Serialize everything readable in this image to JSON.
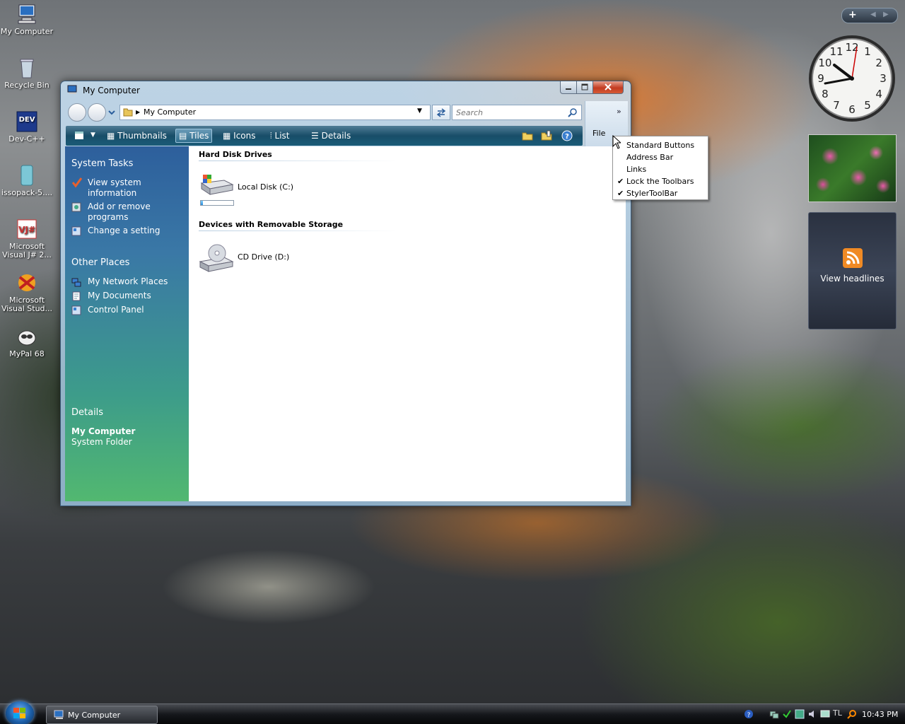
{
  "desktop_icons": [
    {
      "label": "My Computer"
    },
    {
      "label": "Recycle Bin"
    },
    {
      "label": "Dev-C++"
    },
    {
      "label": "issopack-5...."
    },
    {
      "label": "Microsoft Visual J# 2..."
    },
    {
      "label": "Microsoft Visual Stud..."
    },
    {
      "label": "MyPal 68"
    }
  ],
  "window": {
    "title": "My Computer",
    "address": "My Computer",
    "search_placeholder": "Search",
    "right_strip_label": "File",
    "views": [
      {
        "label": "Thumbnails",
        "active": false
      },
      {
        "label": "Tiles",
        "active": true
      },
      {
        "label": "Icons",
        "active": false
      },
      {
        "label": "List",
        "active": false
      },
      {
        "label": "Details",
        "active": false
      }
    ],
    "left_pane": {
      "system_tasks_title": "System Tasks",
      "system_tasks": [
        "View system information",
        "Add or remove programs",
        "Change a setting"
      ],
      "other_places_title": "Other Places",
      "other_places": [
        "My Network Places",
        "My Documents",
        "Control Panel"
      ],
      "details_title": "Details",
      "details_name": "My Computer",
      "details_type": "System Folder"
    },
    "groups": [
      {
        "name": "Hard Disk Drives",
        "items": [
          {
            "label": "Local Disk (C:)",
            "usage": 0.06
          }
        ]
      },
      {
        "name": "Devices with Removable Storage",
        "items": [
          {
            "label": "CD Drive (D:)"
          }
        ]
      }
    ]
  },
  "context_menu": [
    {
      "label": "Standard Buttons",
      "checked": false
    },
    {
      "label": "Address Bar",
      "checked": false
    },
    {
      "label": "Links",
      "checked": false
    },
    {
      "label": "Lock the Toolbars",
      "checked": true
    },
    {
      "label": "StylerToolBar",
      "checked": true
    }
  ],
  "gadgets": {
    "clock_numbers": [
      "12",
      "1",
      "2",
      "3",
      "4",
      "5",
      "6",
      "7",
      "8",
      "9",
      "10",
      "11"
    ],
    "feed_label": "View headlines"
  },
  "taskbar": {
    "task_button": "My Computer",
    "time": "10:43 PM"
  }
}
